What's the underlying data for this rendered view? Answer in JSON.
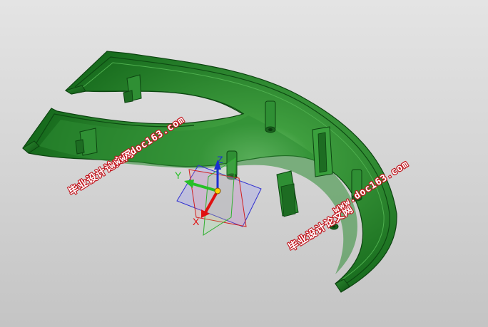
{
  "viewport": {
    "background_top": "#e4e4e4",
    "background_bottom": "#c4c4c4",
    "part_color": "#1f7a24"
  },
  "triad": {
    "x_label": "X",
    "y_label": "Y",
    "z_label": "Z",
    "x_color": "#e01010",
    "y_color": "#27c027",
    "z_color": "#1a2fd0"
  },
  "watermarks": {
    "cn_text": "毕业设计论文网",
    "url_text": "www.doc163.com"
  }
}
